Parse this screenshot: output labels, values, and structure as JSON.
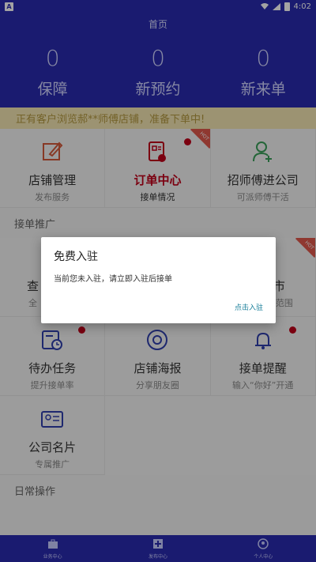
{
  "status_bar": {
    "time": "4:02",
    "app_letter": "A"
  },
  "header": {
    "title": "首页",
    "stats": [
      {
        "value": "0",
        "label": "保障"
      },
      {
        "value": "0",
        "label": "新预约"
      },
      {
        "value": "0",
        "label": "新来单"
      }
    ]
  },
  "notice": "正有客户浏览郝**师傅店铺，准备下单中!",
  "grid1": [
    {
      "title": "店铺管理",
      "sub": "发布服务",
      "icon": "edit-icon"
    },
    {
      "title": "订单中心",
      "sub": "接单情况",
      "icon": "order-icon",
      "badge": "HOT",
      "dot": true
    },
    {
      "title": "招师傅进公司",
      "sub": "可派师傅干活",
      "icon": "add-user-icon"
    }
  ],
  "section_orders": "接单推广",
  "grid2": [
    {
      "title": "查",
      "sub": "全",
      "icon": "search-icon"
    },
    {
      "title": "",
      "sub": "",
      "icon": ""
    },
    {
      "title": "市",
      "sub": "范围",
      "icon": "city-icon",
      "badge": "HOT"
    },
    {
      "title": "待办任务",
      "sub": "提升接单率",
      "icon": "task-icon",
      "dot": true
    },
    {
      "title": "店铺海报",
      "sub": "分享朋友圈",
      "icon": "poster-icon"
    },
    {
      "title": "接单提醒",
      "sub": "输入“你好”开通",
      "icon": "bell-icon",
      "dot": true
    },
    {
      "title": "公司名片",
      "sub": "专属推广",
      "icon": "card-icon"
    }
  ],
  "section_daily": "日常操作",
  "bottom_nav": [
    {
      "label": "业务中心"
    },
    {
      "label": "发布中心"
    },
    {
      "label": "个人中心"
    }
  ],
  "dialog": {
    "title": "免费入驻",
    "message": "当前您未入驻，请立即入驻后接单",
    "action": "点击入驻"
  },
  "colors": {
    "primary": "#2a2bb0",
    "accent": "#c0001a",
    "link": "#1a7f9a"
  }
}
